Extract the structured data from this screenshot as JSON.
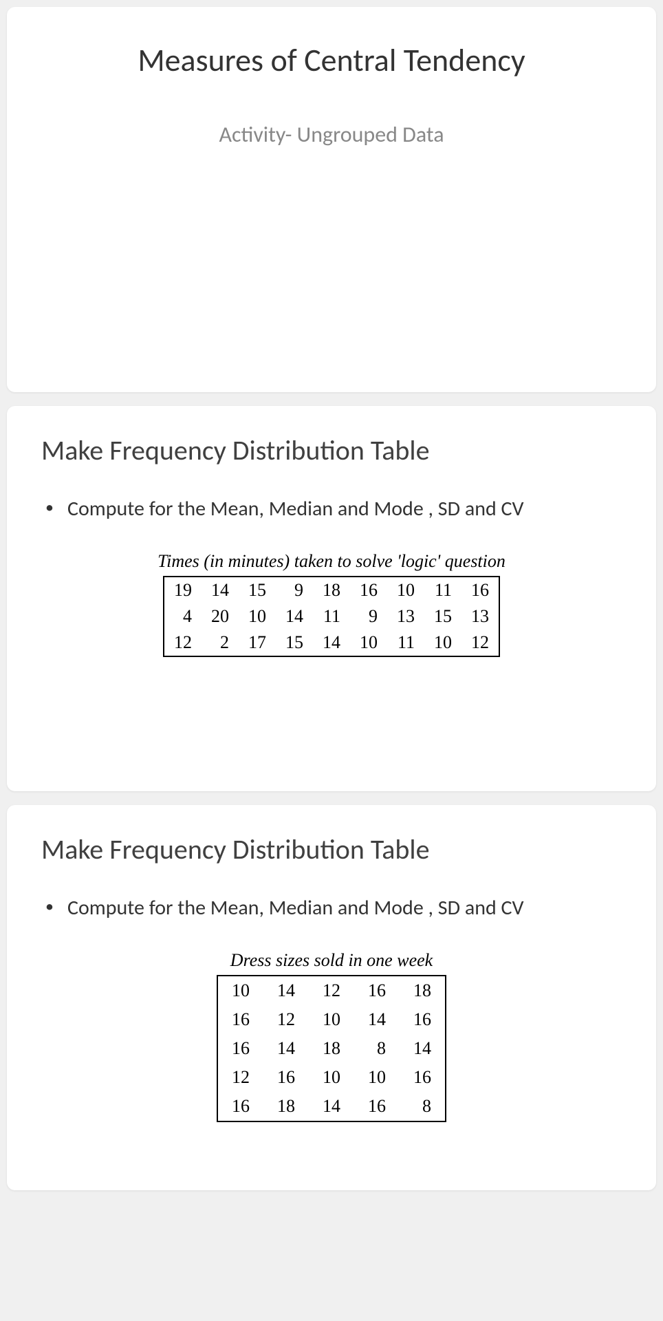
{
  "slide1": {
    "title": "Measures of Central Tendency",
    "subtitle": "Activity- Ungrouped Data"
  },
  "slide2": {
    "title": "Make Frequency Distribution Table",
    "bullet": "Compute for the Mean, Median and Mode , SD and CV",
    "caption": "Times (in minutes) taken to solve 'logic' question",
    "rows": [
      [
        "19",
        "14",
        "15",
        "9",
        "18",
        "16",
        "10",
        "11",
        "16"
      ],
      [
        "4",
        "20",
        "10",
        "14",
        "11",
        "9",
        "13",
        "15",
        "13"
      ],
      [
        "12",
        "2",
        "17",
        "15",
        "14",
        "10",
        "11",
        "10",
        "12"
      ]
    ]
  },
  "slide3": {
    "title": "Make Frequency Distribution Table",
    "bullet": "Compute for the Mean, Median and Mode , SD and CV",
    "caption": "Dress sizes sold in one week",
    "rows": [
      [
        "10",
        "14",
        "12",
        "16",
        "18"
      ],
      [
        "16",
        "12",
        "10",
        "14",
        "16"
      ],
      [
        "16",
        "14",
        "18",
        "8",
        "14"
      ],
      [
        "12",
        "16",
        "10",
        "10",
        "16"
      ],
      [
        "16",
        "18",
        "14",
        "16",
        "8"
      ]
    ]
  },
  "chart_data": [
    {
      "type": "table",
      "title": "Times (in minutes) taken to solve 'logic' question",
      "values": [
        19,
        14,
        15,
        9,
        18,
        16,
        10,
        11,
        16,
        4,
        20,
        10,
        14,
        11,
        9,
        13,
        15,
        13,
        12,
        2,
        17,
        15,
        14,
        10,
        11,
        10,
        12
      ]
    },
    {
      "type": "table",
      "title": "Dress sizes sold in one week",
      "values": [
        10,
        14,
        12,
        16,
        18,
        16,
        12,
        10,
        14,
        16,
        16,
        14,
        18,
        8,
        14,
        12,
        16,
        10,
        10,
        16,
        16,
        18,
        14,
        16,
        8
      ]
    }
  ]
}
